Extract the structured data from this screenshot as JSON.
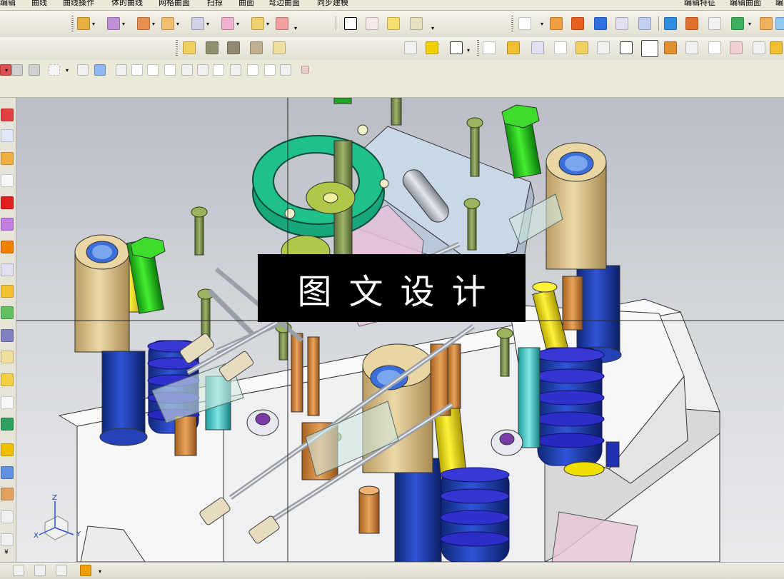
{
  "menubar": {
    "items": [
      "编辑",
      "曲线",
      "曲线操作",
      "体的曲线",
      "网格曲面",
      "扫掠",
      "曲面",
      "弯边曲面",
      "同步建模",
      "编辑特征",
      "编辑曲面",
      "编"
    ]
  },
  "toolbar": {
    "combo_value": ""
  },
  "viewport": {
    "watermark_text": "图文设计",
    "triad": {
      "x_label": "X",
      "y_label": "Y",
      "z_label": "Z"
    },
    "colors": {
      "ring": "#1aa67a",
      "bolt_green": "#22c81e",
      "post_tan": "#d8c08c",
      "post_blue": "#1e3ca8",
      "pin_yellow": "#f0e000",
      "spring_blue": "#3030d0",
      "plate_white": "#f2f2f2",
      "copper": "#d9913a",
      "cyan": "#3ec9c9"
    }
  }
}
